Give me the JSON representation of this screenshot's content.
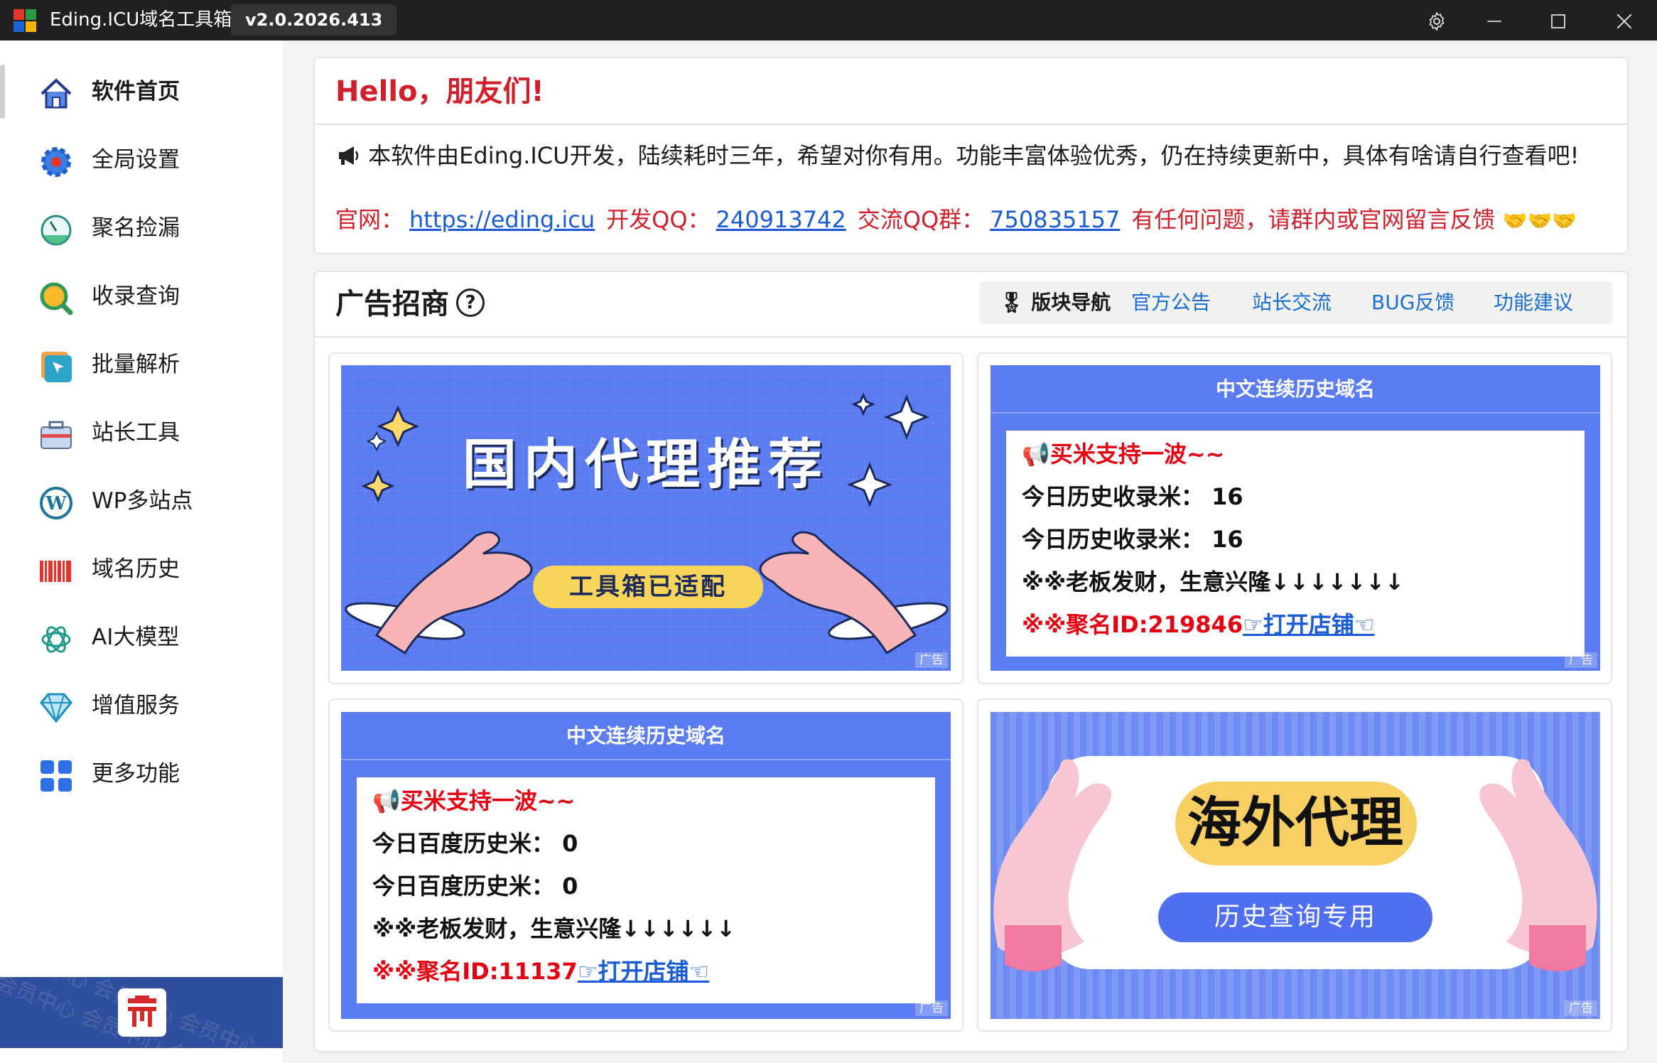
{
  "titlebar": {
    "app_title": "Eding.ICU域名工具箱",
    "version": "v2.0.2026.413",
    "icons": [
      "settings-icon",
      "minimize-icon",
      "maximize-icon",
      "close-icon"
    ]
  },
  "sidebar": {
    "items": [
      {
        "label": "软件首页",
        "icon": "home-icon",
        "active": true
      },
      {
        "label": "全局设置",
        "icon": "gear-icon"
      },
      {
        "label": "聚名捡漏",
        "icon": "gauge-icon"
      },
      {
        "label": "收录查询",
        "icon": "search-icon"
      },
      {
        "label": "批量解析",
        "icon": "cursor-icon"
      },
      {
        "label": "站长工具",
        "icon": "toolbox-icon"
      },
      {
        "label": "WP多站点",
        "icon": "wordpress-icon"
      },
      {
        "label": "域名历史",
        "icon": "barcode-icon"
      },
      {
        "label": "AI大模型",
        "icon": "ai-knot-icon"
      },
      {
        "label": "增值服务",
        "icon": "diamond-icon"
      },
      {
        "label": "更多功能",
        "icon": "apps-grid-icon"
      }
    ],
    "member_watermark": "会员中心"
  },
  "hello": {
    "title": "Hello，朋友们!",
    "intro": "本软件由Eding.ICU开发，陆续耗时三年，希望对你有用。功能丰富体验优秀，仍在持续更新中，具体有啥请自行查看吧!",
    "site_label": "官网：",
    "site_url": "https://eding.icu",
    "qq_label": "开发QQ：",
    "qq": "240913742",
    "group_label": "交流QQ群：",
    "group": "750835157",
    "feedback": "有任何问题，请群内或官网留言反馈"
  },
  "ads": {
    "title": "广告招商",
    "nav_lead": "版块导航",
    "tabs": [
      "官方公告",
      "站长交流",
      "BUG反馈",
      "功能建议"
    ],
    "tag": "广告",
    "banner1": {
      "headline": "国内代理推荐",
      "button": "工具箱已适配"
    },
    "box2": {
      "header": "中文连续历史域名",
      "slogan": "买米支持一波~~",
      "line1_label": "今日历史收录米：",
      "line1_value": "16",
      "line2_label": "今日历史收录米：",
      "line2_value": "16",
      "wish": "※※老板发财，生意兴隆↓↓↓↓↓↓↓",
      "shop_id": "※※聚名ID:219846",
      "shop_link": "打开店铺"
    },
    "box3": {
      "header": "中文连续历史域名",
      "slogan": "买米支持一波~~",
      "line1_label": "今日百度历史米：",
      "line1_value": "0",
      "line2_label": "今日百度历史米：",
      "line2_value": "0",
      "wish": "※※老板发财，生意兴隆↓↓↓↓↓↓",
      "shop_id": "※※聚名ID:11137",
      "shop_link": "打开店铺"
    },
    "banner4": {
      "headline": "海外代理",
      "button": "历史查询专用"
    }
  },
  "colors": {
    "accent_red": "#d21f2c",
    "link_blue": "#1a5cd8",
    "banner_blue": "#5b7cf0",
    "member_blue": "#2f4f9e"
  }
}
